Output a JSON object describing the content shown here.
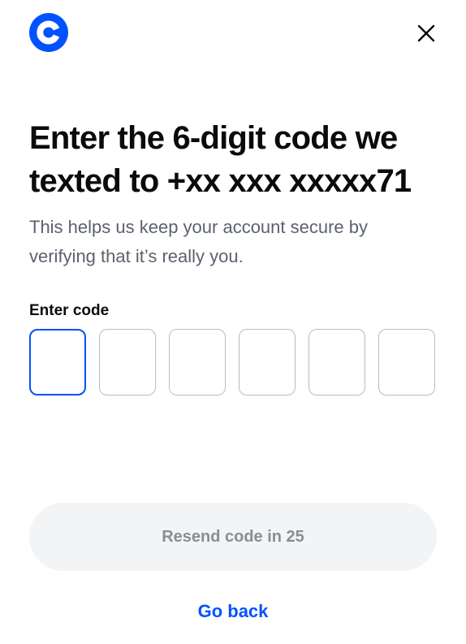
{
  "brand": {
    "logo_icon": "coinbase-logo-icon",
    "accent_color": "#0052ff"
  },
  "header": {
    "close_icon": "close-icon"
  },
  "main": {
    "title": "Enter the 6-digit code we texted to +xx xxx xxxxx71",
    "description": "This helps us keep your account secure by verifying that it’s really you.",
    "code_label": "Enter code",
    "code_digits": [
      "",
      "",
      "",
      "",
      "",
      ""
    ],
    "active_digit_index": 0,
    "resend_label": "Resend code in 25",
    "go_back_label": "Go back"
  },
  "colors": {
    "title": "#0a0b0d",
    "description": "#5b616e",
    "box_border": "#b8bcc4",
    "box_active_border": "#0052ff",
    "resend_bg": "#f3f4f5",
    "resend_text": "#898d96"
  }
}
